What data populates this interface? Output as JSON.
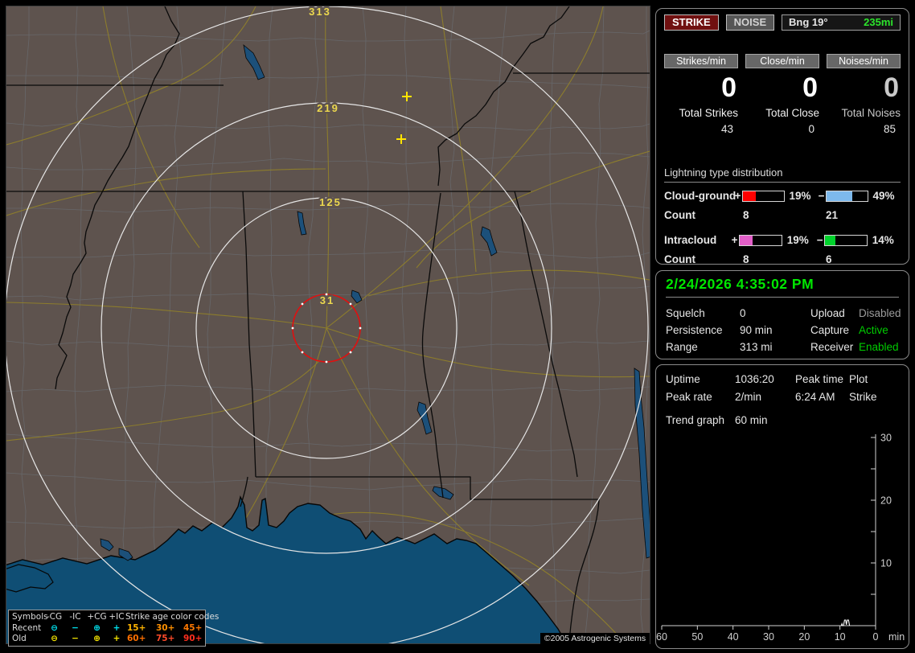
{
  "colors": {
    "accent_green": "#00e800",
    "strike_button_bg": "#701010",
    "cg_plus_bar": "#ff0000",
    "cg_minus_bar": "#7db9ec",
    "ic_plus_bar": "#e25fc8",
    "ic_minus_bar": "#00d22c",
    "recent_symbol": "#00e2ef",
    "old_symbol": "#f4e400",
    "ring_label": "#ecd84e"
  },
  "map": {
    "ring_labels": [
      "313",
      "219",
      "125",
      "31"
    ],
    "strike_symbols": [
      "+",
      "+"
    ],
    "copyright": "©2005 Astrogenic Systems",
    "legend": {
      "symbols_header": "Symbols",
      "col_headers": [
        "-CG",
        "-IC",
        "+CG",
        "+IC"
      ],
      "age_header": "Strike age color codes",
      "rows": [
        {
          "label": "Recent",
          "symbols": [
            "⊖",
            "−",
            "⊕",
            "+"
          ],
          "ages": [
            "15+",
            "30+",
            "45+"
          ]
        },
        {
          "label": "Old",
          "symbols": [
            "⊖",
            "−",
            "⊕",
            "+"
          ],
          "ages": [
            "60+",
            "75+",
            "90+"
          ]
        }
      ],
      "age_colors": [
        "#ffb400",
        "#ff9000",
        "#ff7800",
        "#ff7000",
        "#ff4a2a",
        "#ff2f1e"
      ]
    }
  },
  "panel_top": {
    "strike_button": "STRIKE",
    "noise_button": "NOISE",
    "bearing_label": "Bng 19°",
    "bearing_distance": "235mi",
    "counters": [
      {
        "header": "Strikes/min",
        "rate": "0",
        "total_label": "Total Strikes",
        "total": "43"
      },
      {
        "header": "Close/min",
        "rate": "0",
        "total_label": "Total Close",
        "total": "0"
      },
      {
        "header": "Noises/min",
        "rate": "0",
        "total_label": "Total Noises",
        "total": "85"
      }
    ],
    "distribution": {
      "title": "Lightning type distribution",
      "rows": [
        {
          "label": "Cloud-ground",
          "plus_sign": "+",
          "minus_sign": "−",
          "plus_pct": "19%",
          "minus_pct": "49%",
          "plus_fill": 19,
          "minus_fill": 49,
          "plus_color": "#ff0000",
          "minus_color": "#7db9ec",
          "count_label": "Count",
          "plus_count": "8",
          "minus_count": "21"
        },
        {
          "label": "Intracloud",
          "plus_sign": "+",
          "minus_sign": "−",
          "plus_pct": "19%",
          "minus_pct": "14%",
          "plus_fill": 19,
          "minus_fill": 14,
          "plus_color": "#e25fc8",
          "minus_color": "#00d22c",
          "count_label": "Count",
          "plus_count": "8",
          "minus_count": "6"
        }
      ]
    }
  },
  "panel_status": {
    "datetime": "2/24/2026 4:35:02 PM",
    "rows": [
      {
        "l1": "Squelch",
        "v1": "0",
        "l2": "Upload",
        "v2": "Disabled"
      },
      {
        "l1": "Persistence",
        "v1": "90 min",
        "l2": "Capture",
        "v2": "Active"
      },
      {
        "l1": "Range",
        "v1": "313 mi",
        "l2": "Receiver",
        "v2": "Enabled"
      }
    ]
  },
  "panel_trend": {
    "info": [
      {
        "c1": "Uptime",
        "c2": "1036:20",
        "c3": "Peak time",
        "c4": "Plot"
      },
      {
        "c1": "Peak rate",
        "c2": "2/min",
        "c3": "6:24 AM",
        "c4": "Strike"
      }
    ],
    "trend_label": "Trend graph",
    "trend_value": "60 min"
  },
  "chart_data": {
    "type": "line",
    "title": "Strike trend graph (last 60 min)",
    "xlabel": "min",
    "x_ticks": [
      60,
      50,
      40,
      30,
      20,
      10,
      0
    ],
    "y_ticks_labeled": [
      30,
      20,
      10
    ],
    "y_tick_step": 5,
    "ylim": [
      0,
      30
    ],
    "xlim_minutes_ago": [
      60,
      0
    ],
    "series": [
      {
        "name": "Strike",
        "points_min_ago_value": [
          [
            9.6,
            0
          ],
          [
            9.45,
            0.3
          ],
          [
            9.3,
            0
          ],
          [
            9.0,
            0
          ],
          [
            8.7,
            0.9
          ],
          [
            8.4,
            0.9
          ],
          [
            8.2,
            0.15
          ],
          [
            7.95,
            0.9
          ],
          [
            7.6,
            0.9
          ],
          [
            7.3,
            0
          ]
        ]
      }
    ],
    "legend_position": "none",
    "grid": false
  }
}
